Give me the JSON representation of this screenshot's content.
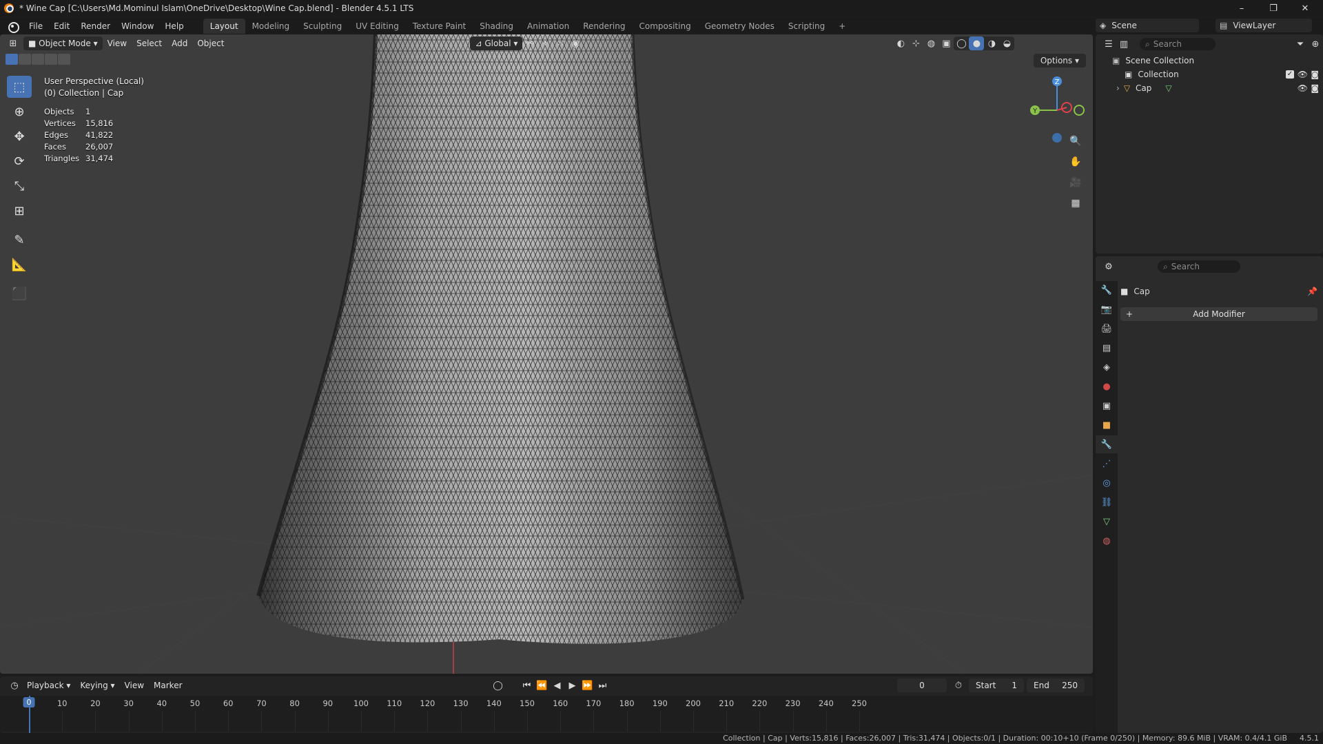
{
  "window": {
    "title": "* Wine Cap [C:\\Users\\Md.Mominul Islam\\OneDrive\\Desktop\\Wine Cap.blend] - Blender 4.5.1 LTS",
    "controls": [
      "–",
      "❐",
      "✕"
    ]
  },
  "menubar": {
    "menus": [
      "File",
      "Edit",
      "Render",
      "Window",
      "Help"
    ],
    "workspaces": [
      "Layout",
      "Modeling",
      "Sculpting",
      "UV Editing",
      "Texture Paint",
      "Shading",
      "Animation",
      "Rendering",
      "Compositing",
      "Geometry Nodes",
      "Scripting"
    ],
    "active_workspace": "Layout",
    "add_tab": "+",
    "scene": "Scene",
    "view_layer": "ViewLayer"
  },
  "viewport": {
    "mode": "Object Mode",
    "menus": [
      "View",
      "Select",
      "Add",
      "Object"
    ],
    "transform_orientation": "Global",
    "options_label": "Options",
    "overlay_line1": "User Perspective (Local)",
    "overlay_line2": "(0) Collection | Cap",
    "stats": [
      {
        "label": "Objects",
        "value": "1"
      },
      {
        "label": "Vertices",
        "value": "15,816"
      },
      {
        "label": "Edges",
        "value": "41,822"
      },
      {
        "label": "Faces",
        "value": "26,007"
      },
      {
        "label": "Triangles",
        "value": "31,474"
      }
    ],
    "gizmo_axes": {
      "z": "Z",
      "y": "Y",
      "x": "X"
    },
    "colors": {
      "x_axis": "#e0414f",
      "y_axis": "#8bc34a",
      "z_axis": "#4a8ee0",
      "active": "#4772b3"
    }
  },
  "outliner": {
    "search_placeholder": "Search",
    "root": "Scene Collection",
    "items": [
      {
        "label": "Collection"
      },
      {
        "label": "Cap"
      }
    ]
  },
  "properties": {
    "search_placeholder": "Search",
    "object_name": "Cap",
    "add_modifier": "Add Modifier"
  },
  "timeline": {
    "menus": [
      "Playback",
      "Keying",
      "View",
      "Marker"
    ],
    "current_frame": "0",
    "start_label": "Start",
    "start_value": "1",
    "end_label": "End",
    "end_value": "250",
    "ticks": [
      "0",
      "10",
      "20",
      "30",
      "40",
      "50",
      "60",
      "70",
      "80",
      "90",
      "100",
      "110",
      "120",
      "130",
      "140",
      "150",
      "160",
      "170",
      "180",
      "190",
      "200",
      "210",
      "220",
      "230",
      "240",
      "250"
    ]
  },
  "statusbar": {
    "text": "Collection | Cap | Verts:15,816 | Faces:26,007 | Tris:31,474 | Objects:0/1 | Duration: 00:10+10 (Frame 0/250) | Memory: 89.6 MiB | VRAM: 0.4/4.1 GiB",
    "version": "4.5.1"
  }
}
